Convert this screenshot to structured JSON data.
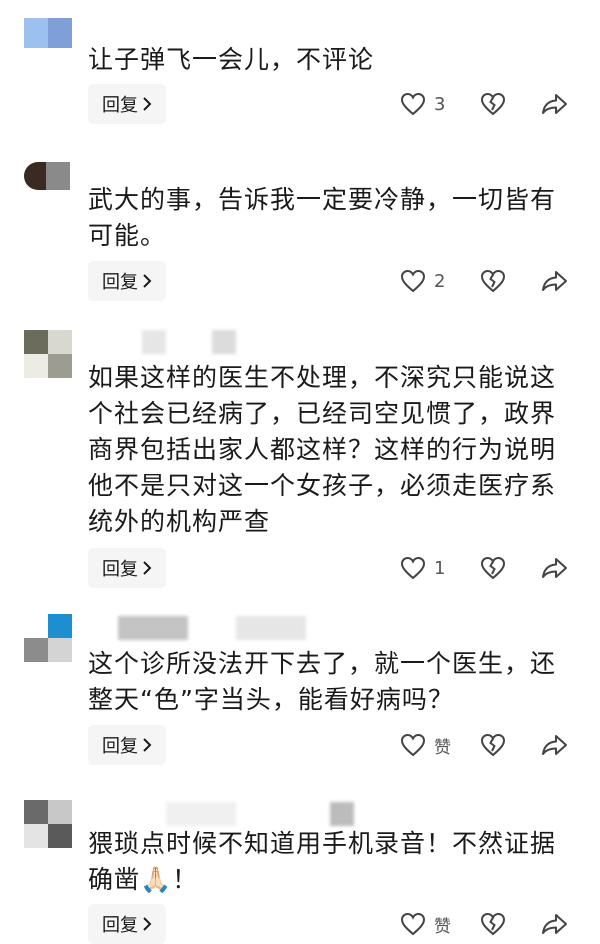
{
  "comments": [
    {
      "text": "让子弹飞一会儿，不评论",
      "reply_label": "回复",
      "like_count": "3",
      "avatar_colors": [
        "#9cc0f0",
        "#7f9fd8",
        "#b0b8e8",
        "#c8d0f0"
      ],
      "name_blur_colors": []
    },
    {
      "text": "武大的事，告诉我一定要冷静，一切皆有可能。",
      "reply_label": "回复",
      "like_count": "2",
      "avatar_colors": [
        "#3a2a22",
        "#8a8a8a",
        "#e8e8e8",
        "#f5f5f5"
      ],
      "name_blur_colors": []
    },
    {
      "text": "如果这样的医生不处理，不深究只能说这个社会已经病了，已经司空见惯了，政界商界包括出家人都这样？这样的行为说明他不是只对这一个女孩子，必须走医疗系统外的机构严查",
      "reply_label": "回复",
      "like_count": "1",
      "avatar_colors": [
        "#6c6c5c",
        "#d8d8d0",
        "#9c9c90",
        "#ecece4"
      ],
      "name_blur_colors": [
        "#e6e6e6",
        "#dcdcdc"
      ]
    },
    {
      "text": "这个诊所没法开下去了，就一个医生，还整天“色”字当头，能看好病吗？",
      "reply_label": "回复",
      "like_count": "赞",
      "avatar_colors": [
        "#ffffff",
        "#1c8fd0",
        "#8c8c8c",
        "#d4d4d4"
      ],
      "name_blur_colors": [
        "#c4c4c4",
        "#e6e6e6"
      ]
    },
    {
      "text": "猥琐点时候不知道用手机录音！不然证据确凿🙏🏻！",
      "reply_label": "回复",
      "like_count": "赞",
      "avatar_colors": [
        "#6a6a6a",
        "#c8c8c8",
        "#e4e4e4",
        "#5a5a5a"
      ],
      "name_blur_colors": [
        "#f0f0f0",
        "#bcbcbc"
      ]
    }
  ]
}
